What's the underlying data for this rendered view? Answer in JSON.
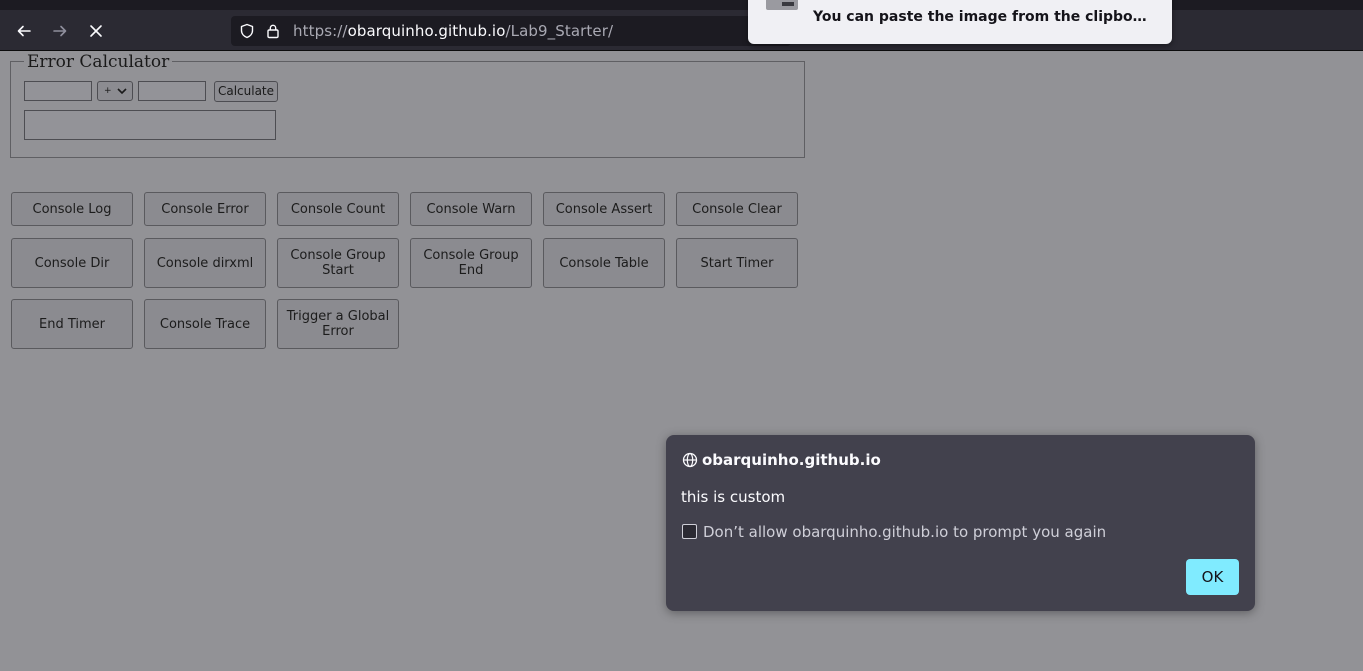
{
  "browser": {
    "url_prefix": "https://",
    "url_domain": "obarquinho.github.io",
    "url_path": "/Lab9_Starter/"
  },
  "notification": {
    "text": "You can paste the image from the clipbo…"
  },
  "calculator": {
    "legend": "Error Calculator",
    "operator": "+",
    "calculate_label": "Calculate"
  },
  "console_buttons": [
    "Console Log",
    "Console Error",
    "Console Count",
    "Console Warn",
    "Console Assert",
    "Console Clear",
    "Console Dir",
    "Console dirxml",
    "Console Group Start",
    "Console Group End",
    "Console Table",
    "Start Timer",
    "End Timer",
    "Console Trace",
    "Trigger a Global Error"
  ],
  "dialog": {
    "host": "obarquinho.github.io",
    "message": "this is custom",
    "checkbox_label": "Don’t allow obarquinho.github.io to prompt you again",
    "ok_label": "OK"
  },
  "colors": {
    "page_dimmed": "#929296",
    "dialog_bg": "#42414d",
    "ok_button": "#80ebff",
    "toolbar": "#2b2a33"
  }
}
